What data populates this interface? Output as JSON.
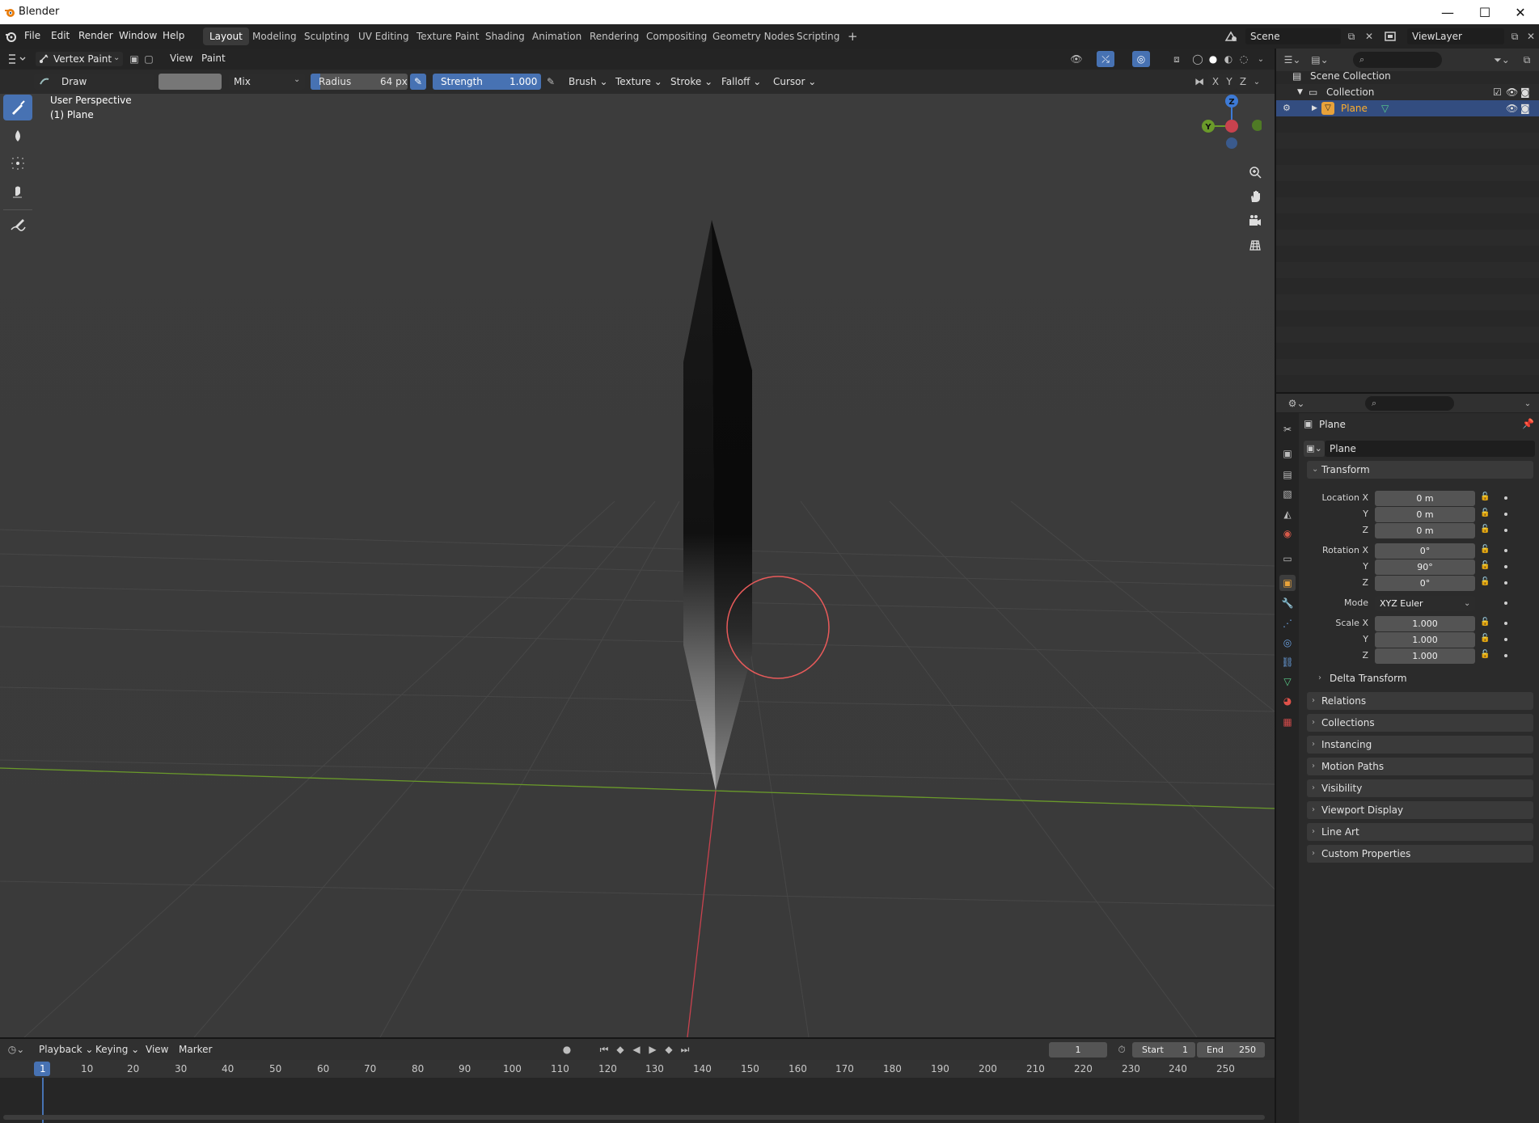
{
  "window": {
    "title": "Blender",
    "minimize": "—",
    "maximize": "☐",
    "close": "✕"
  },
  "menubar": {
    "items": [
      "File",
      "Edit",
      "Render",
      "Window",
      "Help"
    ],
    "workspaces": [
      "Layout",
      "Modeling",
      "Sculpting",
      "UV Editing",
      "Texture Paint",
      "Shading",
      "Animation",
      "Rendering",
      "Compositing",
      "Geometry Nodes",
      "Scripting"
    ],
    "active_workspace": "Layout",
    "add_tab": "+",
    "scene": "Scene",
    "view_layer": "ViewLayer"
  },
  "viewport": {
    "mode": "Vertex Paint",
    "menus": [
      "View",
      "Paint"
    ],
    "tool_header": {
      "brush_name": "Draw",
      "blend": "Mix",
      "radius_label": "Radius",
      "radius_value": "64 px",
      "strength_label": "Strength",
      "strength_value": "1.000",
      "dropdowns": [
        "Brush",
        "Texture",
        "Stroke",
        "Falloff",
        "Cursor"
      ],
      "axes": [
        "X",
        "Y",
        "Z"
      ]
    },
    "overlay": {
      "view_name": "User Perspective",
      "object": "(1) Plane"
    },
    "gizmo": {
      "z": "Z",
      "y": "Y",
      "x": "X"
    },
    "colors": {
      "active_blue": "#4772b3",
      "x_axis": "#c8424e",
      "y_axis": "#6a9a2a",
      "brush_circle": "#e85a5a"
    }
  },
  "outliner": {
    "items": [
      {
        "label": "Scene Collection",
        "icon": "scene-collection-icon"
      },
      {
        "label": "Collection",
        "icon": "collection-icon"
      },
      {
        "label": "Plane",
        "icon": "mesh-object-icon",
        "selected": true
      }
    ]
  },
  "properties": {
    "object_name": "Plane",
    "datablock_name": "Plane",
    "transform": {
      "title": "Transform",
      "location_label": "Location X",
      "location": [
        "0 m",
        "0 m",
        "0 m"
      ],
      "rotation_label": "Rotation X",
      "rotation": [
        "0°",
        "90°",
        "0°"
      ],
      "mode_label": "Mode",
      "mode": "XYZ Euler",
      "scale_label": "Scale X",
      "scale": [
        "1.000",
        "1.000",
        "1.000"
      ],
      "axis_y": "Y",
      "axis_z": "Z",
      "delta": "Delta Transform"
    },
    "panels": [
      "Relations",
      "Collections",
      "Instancing",
      "Motion Paths",
      "Visibility",
      "Viewport Display",
      "Line Art",
      "Custom Properties"
    ]
  },
  "timeline": {
    "menus": [
      "Playback",
      "Keying",
      "View",
      "Marker"
    ],
    "current_frame": "1",
    "start_label": "Start",
    "start": "1",
    "end_label": "End",
    "end": "250",
    "ruler": [
      "1",
      "10",
      "20",
      "30",
      "40",
      "50",
      "60",
      "70",
      "80",
      "90",
      "100",
      "110",
      "120",
      "130",
      "140",
      "150",
      "160",
      "170",
      "180",
      "190",
      "200",
      "210",
      "220",
      "230",
      "240",
      "250"
    ]
  }
}
